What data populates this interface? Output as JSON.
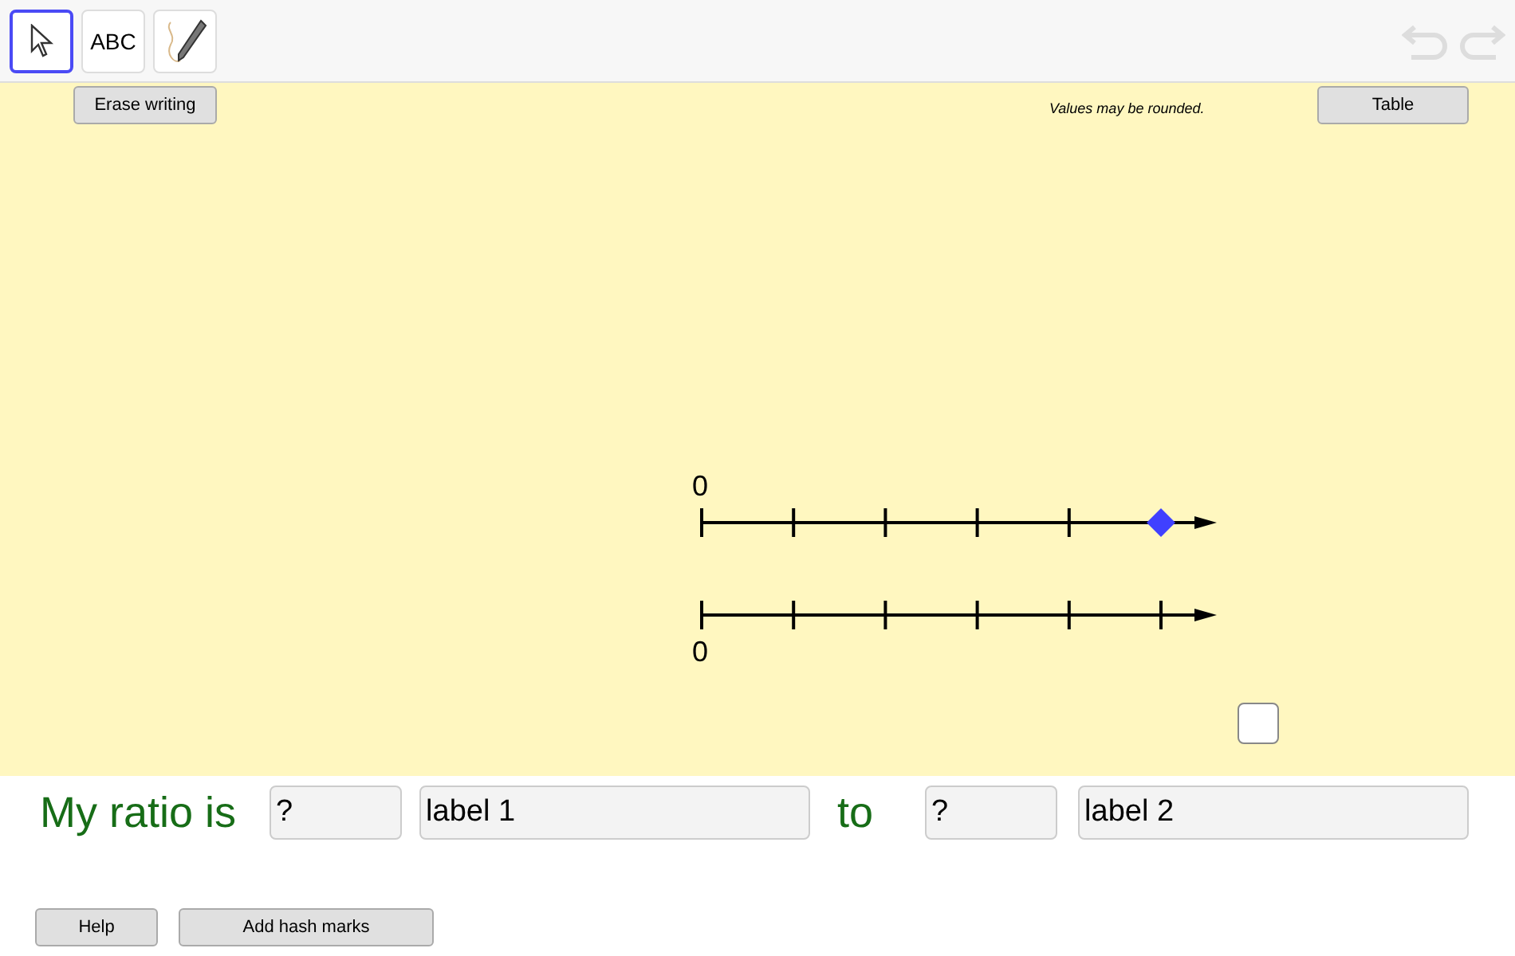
{
  "toolbar": {
    "tools": [
      {
        "kind": "pointer",
        "selected": true
      },
      {
        "kind": "text",
        "label": "ABC",
        "selected": false
      },
      {
        "kind": "pen",
        "selected": false
      }
    ],
    "undo": {
      "disabled": true
    },
    "redo": {
      "disabled": true
    }
  },
  "canvas": {
    "erase_button": "Erase writing",
    "note": "Values may be rounded.",
    "table_button": "Table",
    "number_lines": [
      {
        "kind": "upper",
        "zero_label": "0",
        "has_point": true
      },
      {
        "kind": "lower",
        "zero_label": "0",
        "has_point": false
      }
    ],
    "checkbox": {
      "checked": false
    }
  },
  "ratio": {
    "prefix": "My ratio is",
    "value_1": "?",
    "label_1": "label 1",
    "connector": "to",
    "value_2": "?",
    "label_2": "label 2"
  },
  "buttons": [
    "Help",
    "Add hash marks"
  ]
}
